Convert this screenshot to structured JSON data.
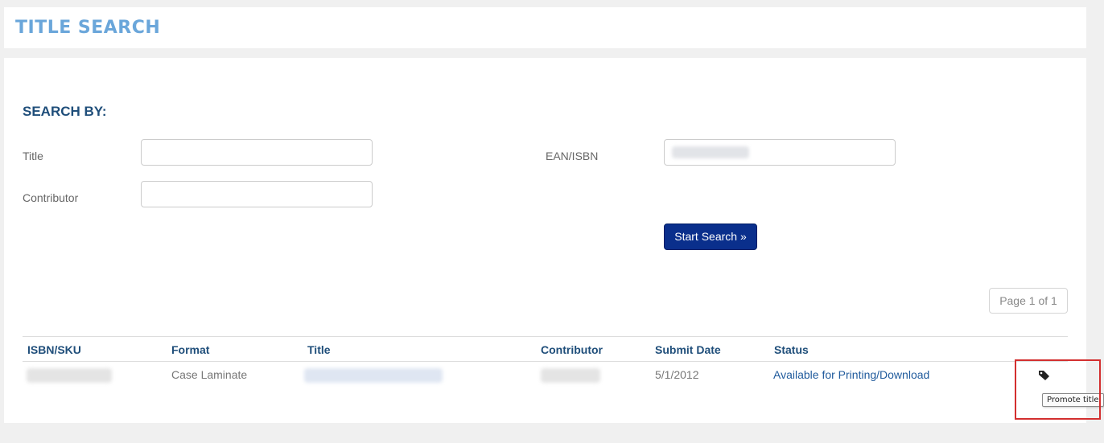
{
  "header": {
    "title": "TITLE SEARCH"
  },
  "search": {
    "heading": "SEARCH BY:",
    "title_label": "Title",
    "title_value": "",
    "contributor_label": "Contributor",
    "contributor_value": "",
    "ean_label": "EAN/ISBN",
    "start_button_label": "Start Search »"
  },
  "pagination": {
    "label": "Page 1 of 1"
  },
  "table": {
    "columns": [
      "ISBN/SKU",
      "Format",
      "Title",
      "Contributor",
      "Submit Date",
      "Status"
    ],
    "rows": [
      {
        "format": "Case Laminate",
        "submit_date": "5/1/2012",
        "status": "Available for Printing/Download",
        "action_icon": "tag-icon"
      }
    ]
  },
  "tooltip": {
    "text": "Promote title"
  },
  "colors": {
    "title_blue": "#6aa6da",
    "heading_navy": "#1f4e7a",
    "link_blue": "#1f5a9c",
    "button_bg": "#0a2f8c",
    "highlight_red": "#d32f2f",
    "page_bg": "#f0f0f0"
  }
}
